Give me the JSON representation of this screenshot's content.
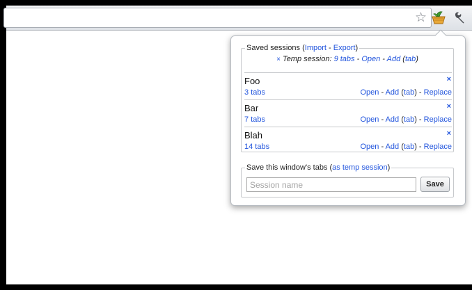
{
  "toolbar": {
    "icons": [
      "star-icon",
      "session-manager-extension-icon",
      "wrench-icon"
    ],
    "star_glyph": "☆"
  },
  "popup": {
    "saved_sessions": {
      "legend_prefix": "Saved sessions (",
      "import_label": "Import",
      "separator": " - ",
      "export_label": "Export",
      "legend_suffix": ")"
    },
    "temp_session": {
      "delete_glyph": "×",
      "label": "Temp session:",
      "tabs_label": "9 tabs",
      "open_label": "Open",
      "add_label": "Add",
      "tab_label": "tab"
    },
    "sessions": [
      {
        "name": "Foo",
        "tabs": "3 tabs",
        "delete_glyph": "×",
        "open": "Open",
        "add": "Add",
        "tab": "tab",
        "replace": "Replace"
      },
      {
        "name": "Bar",
        "tabs": "7 tabs",
        "delete_glyph": "×",
        "open": "Open",
        "add": "Add",
        "tab": "tab",
        "replace": "Replace"
      },
      {
        "name": "Blah",
        "tabs": "14 tabs",
        "delete_glyph": "×",
        "open": "Open",
        "add": "Add",
        "tab": "tab",
        "replace": "Replace"
      }
    ],
    "save": {
      "legend_prefix": "Save this window's tabs (",
      "temp_link": "as temp session",
      "legend_suffix": ")",
      "input_placeholder": "Session name",
      "input_value": "",
      "button_label": "Save"
    }
  },
  "colors": {
    "link": "#2255dd",
    "border": "#c7c9cc"
  }
}
